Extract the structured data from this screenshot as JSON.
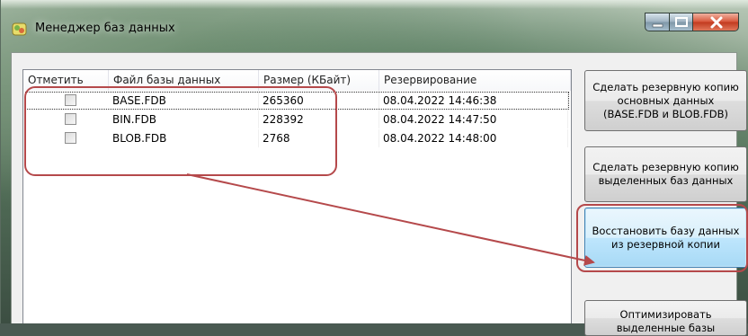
{
  "window": {
    "title": "Менеджер баз данных"
  },
  "list": {
    "columns": [
      "Отметить",
      "Файл базы данных",
      "Размер (КБайт)",
      "Резервирование"
    ],
    "rows": [
      {
        "file": "BASE.FDB",
        "size": "265360",
        "backup": "08.04.2022 14:46:38"
      },
      {
        "file": "BIN.FDB",
        "size": "228392",
        "backup": "08.04.2022 14:47:50"
      },
      {
        "file": "BLOB.FDB",
        "size": "2768",
        "backup": "08.04.2022 14:48:00"
      }
    ]
  },
  "buttons": {
    "backup_main": "Сделать резервную копию основных данных (BASE.FDB и BLOB.FDB)",
    "backup_selected": "Сделать резервную копию выделенных баз данных",
    "restore": "Восстановить базу данных из резервной копии",
    "optimize": "Оптимизировать выделенные базы"
  },
  "colors": {
    "annotation": "#b5494b",
    "hot_button_border": "#3c7fb1"
  },
  "icons": {
    "app": "database-app-icon",
    "minimize": "minimize-icon",
    "maximize": "maximize-icon",
    "close": "close-icon"
  }
}
